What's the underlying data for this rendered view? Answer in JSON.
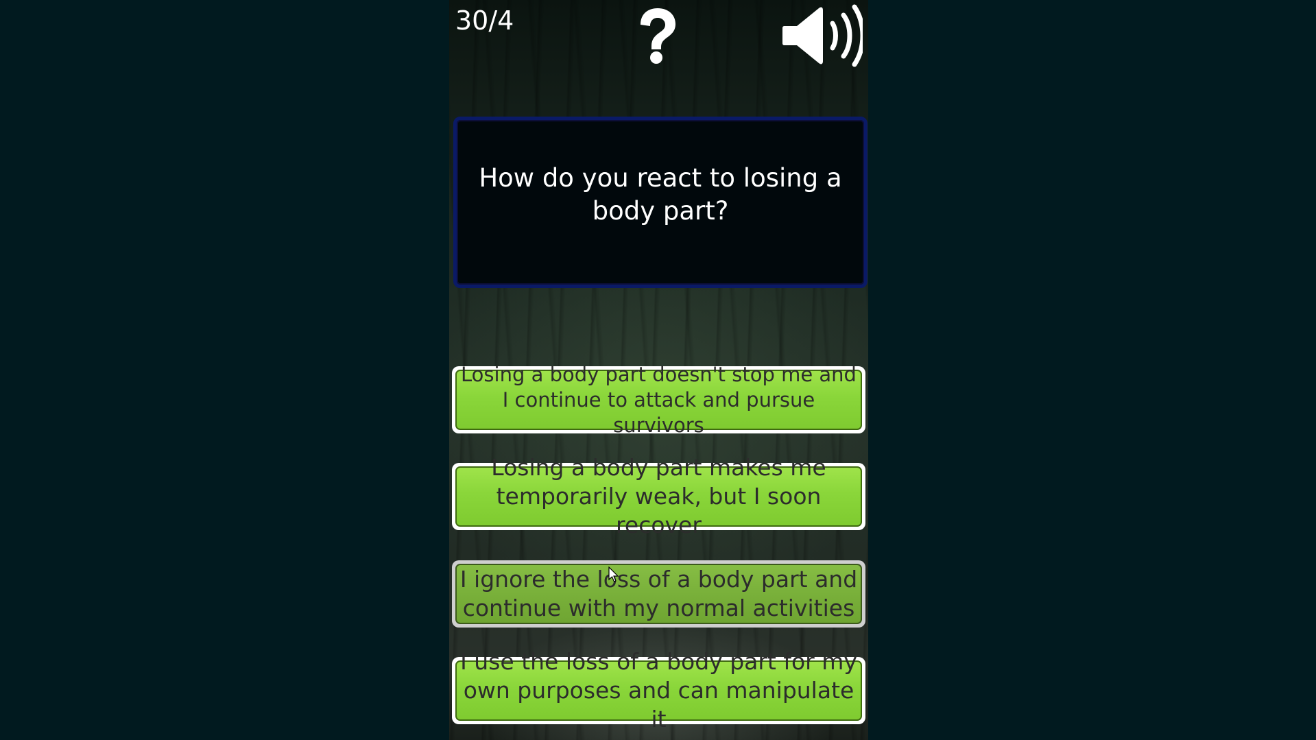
{
  "hud": {
    "counter": "30/4",
    "help_icon": "question-mark-icon",
    "sound_icon": "speaker-volume-icon"
  },
  "question": {
    "text": "How do you react to losing a body part?"
  },
  "answers": [
    {
      "label": "Losing a body part doesn't stop me and I continue to attack and pursue survivors"
    },
    {
      "label": "Losing a body part makes me temporarily weak, but I soon recover"
    },
    {
      "label": "I ignore the loss of a body part and continue with my normal activities"
    },
    {
      "label": "I use the loss of a body part for my own purposes and can manipulate it"
    }
  ],
  "colors": {
    "page_background": "#011a1f",
    "answer_green": "#8ad63a",
    "answer_border": "#ffffff",
    "question_border": "#0a1a66",
    "question_background": "#01080c"
  }
}
